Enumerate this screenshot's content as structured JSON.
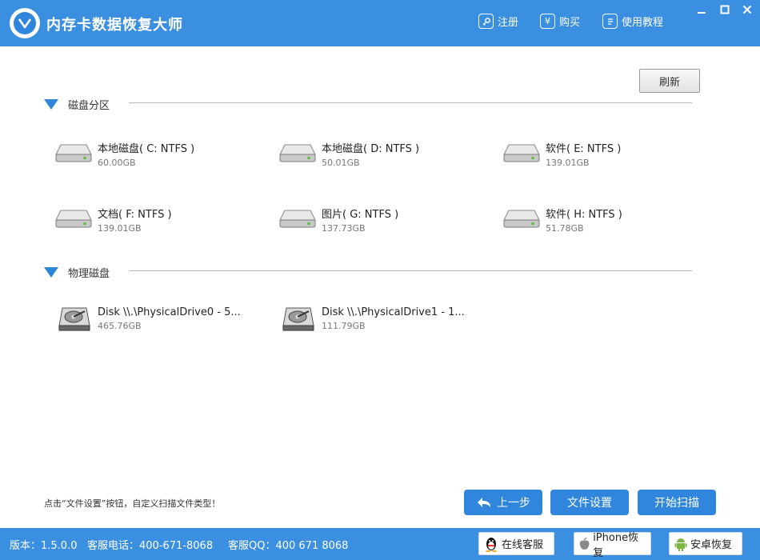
{
  "app": {
    "title": "内存卡数据恢复大师"
  },
  "header_links": [
    {
      "label": "注册",
      "icon": "key-icon"
    },
    {
      "label": "购买",
      "icon": "yen-icon"
    },
    {
      "label": "使用教程",
      "icon": "book-icon"
    }
  ],
  "toolbar": {
    "refresh_label": "刷新"
  },
  "sections": {
    "partitions": "磁盘分区",
    "physical": "物理磁盘"
  },
  "partitions": [
    {
      "name": "本地磁盘( C: NTFS )",
      "size": "60.00GB"
    },
    {
      "name": "本地磁盘( D: NTFS )",
      "size": "50.01GB"
    },
    {
      "name": "软件( E: NTFS )",
      "size": "139.01GB"
    },
    {
      "name": "文档( F: NTFS )",
      "size": "139.01GB"
    },
    {
      "name": "图片( G: NTFS )",
      "size": "137.73GB"
    },
    {
      "name": "软件( H: NTFS )",
      "size": "51.78GB"
    }
  ],
  "physical_disks": [
    {
      "name": "Disk \\\\.\\PhysicalDrive0 - 5...",
      "size": "465.76GB"
    },
    {
      "name": "Disk \\\\.\\PhysicalDrive1 - 1...",
      "size": "111.79GB"
    }
  ],
  "footer": {
    "hint": "点击“文件设置”按钮，自定义扫描文件类型！",
    "back_label": "上一步",
    "settings_label": "文件设置",
    "scan_label": "开始扫描"
  },
  "status": {
    "version": "版本：1.5.0.0",
    "phone": "客服电话：400-671-8068",
    "qq": "客服QQ：400 671 8068",
    "online_service": "在线客服",
    "iphone_recovery": "iPhone恢复",
    "android_recovery": "安卓恢复"
  },
  "colors": {
    "accent": "#3b8fe0",
    "button": "#2f86dc"
  }
}
